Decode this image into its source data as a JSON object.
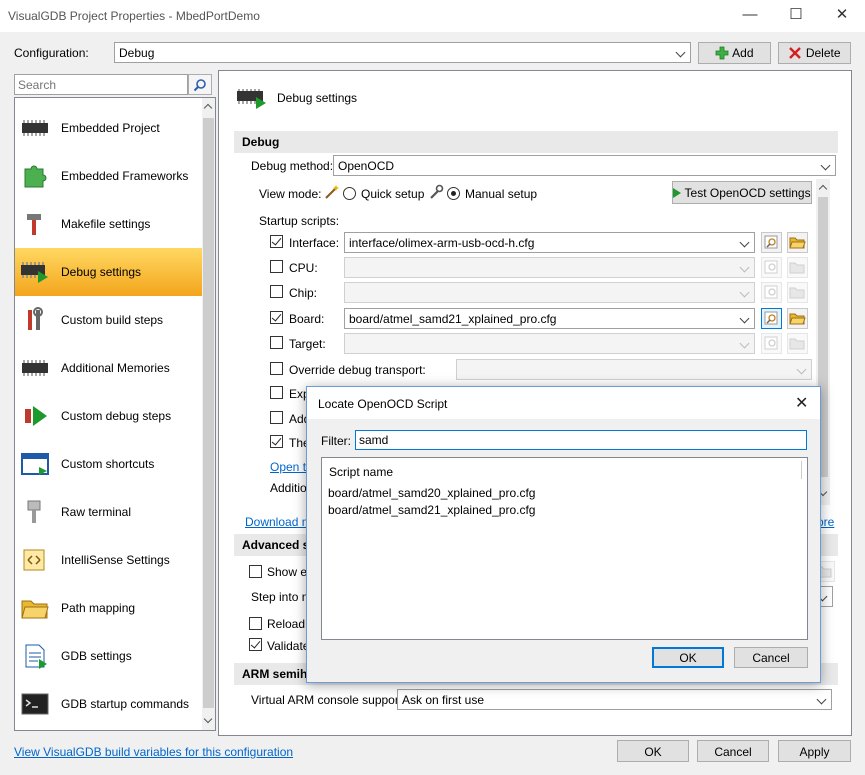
{
  "window": {
    "title": "VisualGDB Project Properties - MbedPortDemo",
    "min": "—",
    "max": "☐",
    "close": "✕"
  },
  "config": {
    "label": "Configuration:",
    "value": "Debug",
    "add": "Add",
    "delete": "Delete"
  },
  "search": {
    "placeholder": "Search"
  },
  "sidebar": {
    "items": [
      {
        "label": "Embedded Project",
        "icon": "chip-icon"
      },
      {
        "label": "Embedded Frameworks",
        "icon": "puzzle-icon"
      },
      {
        "label": "Makefile settings",
        "icon": "hammer-icon"
      },
      {
        "label": "Debug settings",
        "icon": "debug-chip-icon"
      },
      {
        "label": "Custom build steps",
        "icon": "tools-icon"
      },
      {
        "label": "Additional Memories",
        "icon": "memory-chip-icon"
      },
      {
        "label": "Custom debug steps",
        "icon": "debug-steps-icon"
      },
      {
        "label": "Custom shortcuts",
        "icon": "window-icon"
      },
      {
        "label": "Raw terminal",
        "icon": "serial-connector-icon"
      },
      {
        "label": "IntelliSense Settings",
        "icon": "intellisense-icon"
      },
      {
        "label": "Path mapping",
        "icon": "folder-icon"
      },
      {
        "label": "GDB settings",
        "icon": "document-icon"
      },
      {
        "label": "GDB startup commands",
        "icon": "console-icon"
      }
    ]
  },
  "panel": {
    "header": "Debug settings",
    "debug_section": "Debug",
    "debug_method_label": "Debug method:",
    "debug_method_value": "OpenOCD",
    "view_mode_label": "View mode:",
    "quick_setup": "Quick setup",
    "manual_setup": "Manual setup",
    "test_button": "Test OpenOCD settings",
    "startup_scripts": "Startup scripts:",
    "scripts": [
      {
        "label": "Interface:",
        "checked": true,
        "value": "interface/olimex-arm-usb-ocd-h.cfg"
      },
      {
        "label": "CPU:",
        "checked": false,
        "value": ""
      },
      {
        "label": "Chip:",
        "checked": false,
        "value": ""
      },
      {
        "label": "Board:",
        "checked": true,
        "value": "board/atmel_samd21_xplained_pro.cfg"
      },
      {
        "label": "Target:",
        "checked": false,
        "value": ""
      }
    ],
    "override_transport": "Override debug transport:",
    "exp_label": "Exp",
    "add_label": "Add",
    "the_label": "The",
    "open_link": "Open th",
    "addition_label": "Addition",
    "download_link": "Download mo",
    "more_link": "ore",
    "advanced_section": "Advanced s",
    "show_label": "Show en",
    "step_into_label": "Step into ne",
    "reload_label": "Reload f",
    "validate_label": "Validate",
    "arm_section": "ARM semih",
    "virtual_console_label": "Virtual ARM console support:",
    "virtual_console_value": "Ask on first use"
  },
  "dialog": {
    "title": "Locate OpenOCD Script",
    "filter_label": "Filter:",
    "filter_value": "samd",
    "column": "Script name",
    "results": [
      "board/atmel_samd20_xplained_pro.cfg",
      "board/atmel_samd21_xplained_pro.cfg"
    ],
    "ok": "OK",
    "cancel": "Cancel"
  },
  "footer": {
    "link": "View VisualGDB build variables for this configuration",
    "ok": "OK",
    "cancel": "Cancel",
    "apply": "Apply"
  }
}
